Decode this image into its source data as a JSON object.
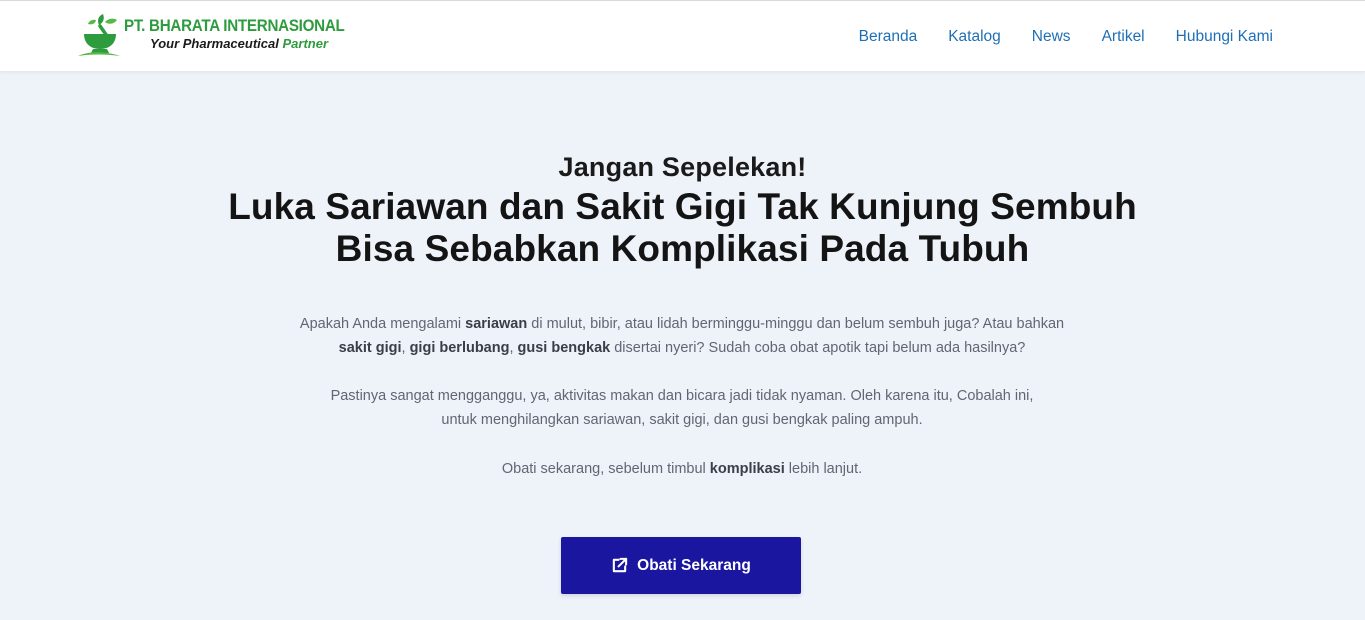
{
  "brand": {
    "name": "PT. BHARATA INTERNASIONAL",
    "tagline_part1": "Your Pharmaceutical",
    "tagline_part2": "Partner",
    "logo_icon": "mortar-pestle-leaf-icon",
    "green": "#2e9c3e"
  },
  "nav": {
    "items": [
      {
        "label": "Beranda"
      },
      {
        "label": "Katalog"
      },
      {
        "label": "News"
      },
      {
        "label": "Artikel"
      },
      {
        "label": "Hubungi Kami"
      }
    ],
    "color": "#1f6fb6"
  },
  "hero": {
    "kicker": "Jangan Sepelekan!",
    "headline_line1": "Luka Sariawan dan Sakit Gigi Tak Kunjung Sembuh",
    "headline_line2": "Bisa Sebabkan Komplikasi Pada Tubuh",
    "p1": {
      "t1": "Apakah Anda mengalami ",
      "b1": "sariawan",
      "t2": " di mulut, bibir, atau lidah berminggu-minggu dan belum sembuh juga? Atau bahkan ",
      "b2": "sakit gigi",
      "t3": ", ",
      "b3": "gigi berlubang",
      "t4": ", ",
      "b4": "gusi bengkak",
      "t5": " disertai nyeri? Sudah coba obat apotik tapi belum ada hasilnya?"
    },
    "p2": {
      "line1": "Pastinya sangat mengganggu, ya, aktivitas makan dan bicara jadi tidak nyaman. Oleh karena itu, Cobalah ini,",
      "line2": "untuk menghilangkan sariawan, sakit gigi, dan gusi bengkak paling ampuh."
    },
    "p3": {
      "t1": "Obati sekarang, sebelum timbul ",
      "b1": "komplikasi",
      "t2": " lebih lanjut."
    },
    "cta": {
      "label": "Obati Sekarang",
      "icon": "external-link-icon",
      "color": "#1a16a0"
    }
  }
}
